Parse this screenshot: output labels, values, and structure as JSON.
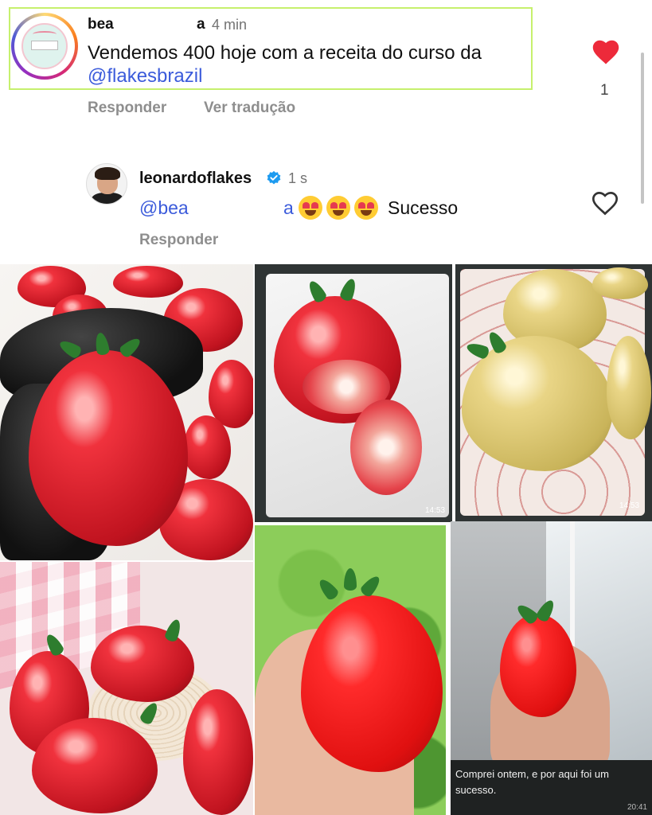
{
  "comment1": {
    "username_prefix": "bea",
    "username_suffix": "a",
    "time": "4 min",
    "text": "Vendemos 400 hoje com a receita do curso da ",
    "mention": "@flakesbrazil",
    "reply_label": "Responder",
    "translate_label": "Ver tradução",
    "like_count": "1",
    "liked": true,
    "heart_color": "#ed2a3a",
    "highlight_color": "#c6f06d"
  },
  "comment2": {
    "username": "leonardoflakes",
    "verified": true,
    "time": "1 s",
    "mention_prefix": "@bea",
    "mention_suffix": "a",
    "emojis": [
      "heart-eyes",
      "heart-eyes",
      "heart-eyes"
    ],
    "text": "Sucesso",
    "reply_label": "Responder",
    "liked": false
  },
  "collage": {
    "photo2_time": "14:53",
    "photo3_time": "14:53",
    "photo6_caption": "Comprei ontem, e por aqui foi um sucesso.",
    "photo6_time": "20:41"
  },
  "colors": {
    "mention": "#3b5bdb",
    "secondary_text": "#8e8e8e",
    "verified": "#1d9bf0"
  }
}
